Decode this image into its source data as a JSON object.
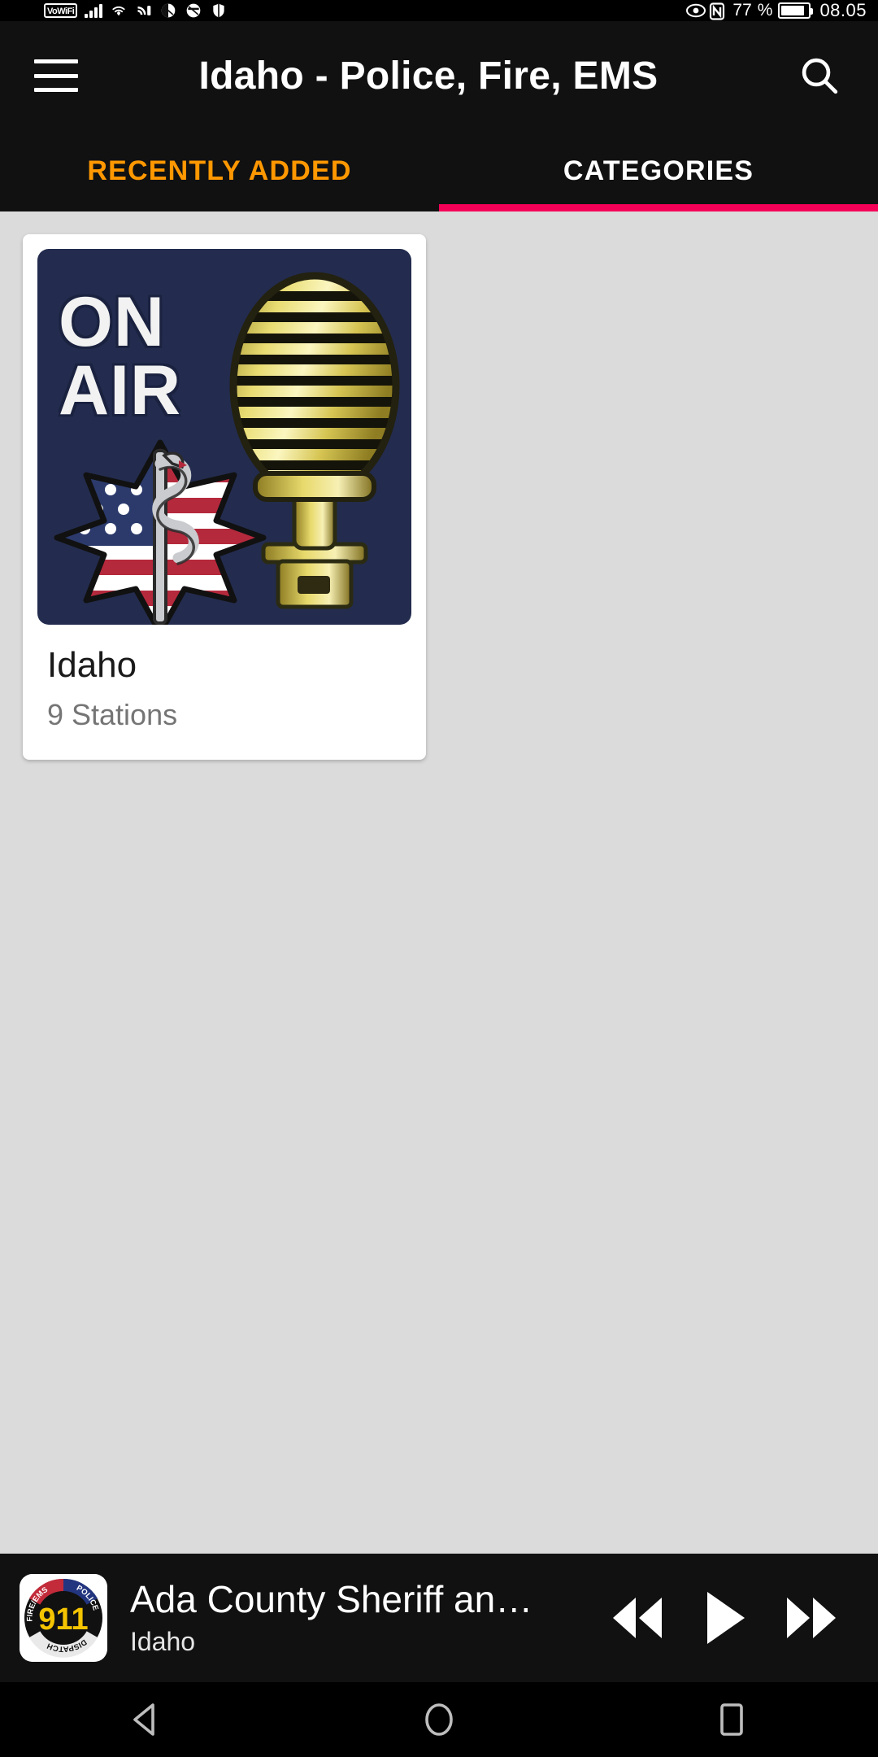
{
  "status_bar": {
    "vowifi_label": "VoWiFi",
    "battery_percent": "77",
    "percent_symbol": "%",
    "time": "08.05",
    "icons": [
      "vowifi-badge",
      "signal-bars-icon",
      "wifi-icon",
      "cast-icon",
      "circle-icon-1",
      "circle-icon-2",
      "shield-icon",
      "eye-icon",
      "nfc-icon",
      "battery-icon"
    ]
  },
  "app_bar": {
    "title": "Idaho - Police, Fire, EMS",
    "menu_icon": "hamburger-menu-icon",
    "search_icon": "search-icon"
  },
  "tabs": {
    "indicator_color": "#F50057",
    "inactive_color": "#FF9800",
    "active_color": "#FFFFFF",
    "items": [
      {
        "label": "RECENTLY ADDED",
        "selected": false
      },
      {
        "label": "CATEGORIES",
        "selected": true
      }
    ]
  },
  "content": {
    "background_color": "#DBDBDB",
    "cards": [
      {
        "title": "Idaho",
        "subtitle": "9 Stations",
        "artwork": {
          "name": "on-air-microphone-artwork",
          "background_color": "#232C4E",
          "text_line_1": "ON",
          "text_line_2": "AIR",
          "elements": [
            "star-of-life-us-flag-icon",
            "gold-vintage-microphone-icon"
          ]
        }
      }
    ]
  },
  "player": {
    "thumbnail": {
      "name": "911-dispatch-badge-icon",
      "center_text": "911",
      "arc_top_left": "FIRE/EMS",
      "arc_top_right": "POLICE",
      "arc_bottom": "DISPATCH"
    },
    "title": "Ada County Sheriff an…",
    "subtitle": "Idaho",
    "controls": [
      {
        "name": "rewind-button",
        "icon": "rewind-icon"
      },
      {
        "name": "play-button",
        "icon": "play-icon"
      },
      {
        "name": "fast-forward-button",
        "icon": "fast-forward-icon"
      }
    ]
  },
  "nav_bar": {
    "buttons": [
      {
        "name": "back-button",
        "icon": "back-triangle-icon"
      },
      {
        "name": "home-button",
        "icon": "home-circle-icon"
      },
      {
        "name": "recents-button",
        "icon": "recents-square-icon"
      }
    ]
  }
}
